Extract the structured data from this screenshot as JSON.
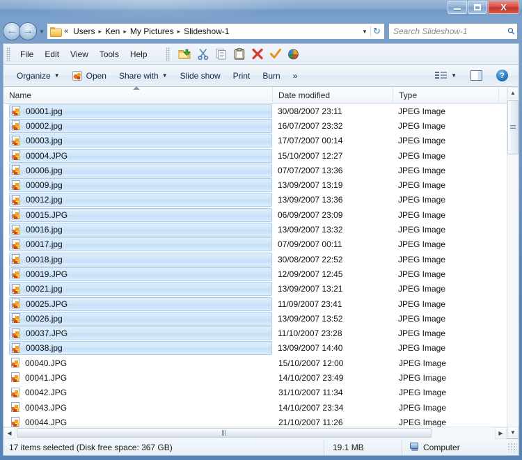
{
  "window": {
    "controls": {
      "minimize": "Minimize",
      "maximize": "Maximize",
      "close": "X"
    }
  },
  "address": {
    "prev_chevron": "«",
    "crumbs": [
      "Users",
      "Ken",
      "My Pictures",
      "Slideshow-1"
    ],
    "separator": "▸",
    "dropdown": "▼",
    "refresh": "↻"
  },
  "search": {
    "placeholder": "Search Slideshow-1"
  },
  "menubar": {
    "items": [
      "File",
      "Edit",
      "View",
      "Tools",
      "Help"
    ],
    "icons": [
      "move-to-folder-icon",
      "cut-icon",
      "copy-icon",
      "paste-icon",
      "delete-icon",
      "check-icon",
      "properties-icon"
    ]
  },
  "toolbar": {
    "organize": "Organize",
    "open": "Open",
    "share_with": "Share with",
    "slide_show": "Slide show",
    "print": "Print",
    "burn": "Burn",
    "overflow": "»",
    "views_label": "Views",
    "preview_label": "Preview pane",
    "help_label": "?"
  },
  "columns": {
    "name": "Name",
    "date_modified": "Date modified",
    "type": "Type"
  },
  "files": [
    {
      "name": "00001.jpg",
      "date": "30/08/2007 23:11",
      "type": "JPEG Image",
      "selected": true
    },
    {
      "name": "00002.jpg",
      "date": "16/07/2007 23:32",
      "type": "JPEG Image",
      "selected": true
    },
    {
      "name": "00003.jpg",
      "date": "17/07/2007 00:14",
      "type": "JPEG Image",
      "selected": true
    },
    {
      "name": "00004.JPG",
      "date": "15/10/2007 12:27",
      "type": "JPEG Image",
      "selected": true
    },
    {
      "name": "00006.jpg",
      "date": "07/07/2007 13:36",
      "type": "JPEG Image",
      "selected": true
    },
    {
      "name": "00009.jpg",
      "date": "13/09/2007 13:19",
      "type": "JPEG Image",
      "selected": true
    },
    {
      "name": "00012.jpg",
      "date": "13/09/2007 13:36",
      "type": "JPEG Image",
      "selected": true
    },
    {
      "name": "00015.JPG",
      "date": "06/09/2007 23:09",
      "type": "JPEG Image",
      "selected": true
    },
    {
      "name": "00016.jpg",
      "date": "13/09/2007 13:32",
      "type": "JPEG Image",
      "selected": true
    },
    {
      "name": "00017.jpg",
      "date": "07/09/2007 00:11",
      "type": "JPEG Image",
      "selected": true
    },
    {
      "name": "00018.jpg",
      "date": "30/08/2007 22:52",
      "type": "JPEG Image",
      "selected": true
    },
    {
      "name": "00019.JPG",
      "date": "12/09/2007 12:45",
      "type": "JPEG Image",
      "selected": true
    },
    {
      "name": "00021.jpg",
      "date": "13/09/2007 13:21",
      "type": "JPEG Image",
      "selected": true
    },
    {
      "name": "00025.JPG",
      "date": "11/09/2007 23:41",
      "type": "JPEG Image",
      "selected": true
    },
    {
      "name": "00026.jpg",
      "date": "13/09/2007 13:52",
      "type": "JPEG Image",
      "selected": true
    },
    {
      "name": "00037.JPG",
      "date": "11/10/2007 23:28",
      "type": "JPEG Image",
      "selected": true
    },
    {
      "name": "00038.jpg",
      "date": "13/09/2007 14:40",
      "type": "JPEG Image",
      "selected": true
    },
    {
      "name": "00040.JPG",
      "date": "15/10/2007 12:00",
      "type": "JPEG Image",
      "selected": false
    },
    {
      "name": "00041.JPG",
      "date": "14/10/2007 23:49",
      "type": "JPEG Image",
      "selected": false
    },
    {
      "name": "00042.JPG",
      "date": "31/10/2007 11:34",
      "type": "JPEG Image",
      "selected": false
    },
    {
      "name": "00043.JPG",
      "date": "14/10/2007 23:34",
      "type": "JPEG Image",
      "selected": false
    },
    {
      "name": "00044.JPG",
      "date": "21/10/2007 11:26",
      "type": "JPEG Image",
      "selected": false
    }
  ],
  "status": {
    "selection": "17 items selected (Disk free space: 367 GB)",
    "size": "19.1 MB",
    "location": "Computer"
  },
  "scrollbars": {
    "up": "▲",
    "down": "▼",
    "left": "◀",
    "right": "▶"
  }
}
